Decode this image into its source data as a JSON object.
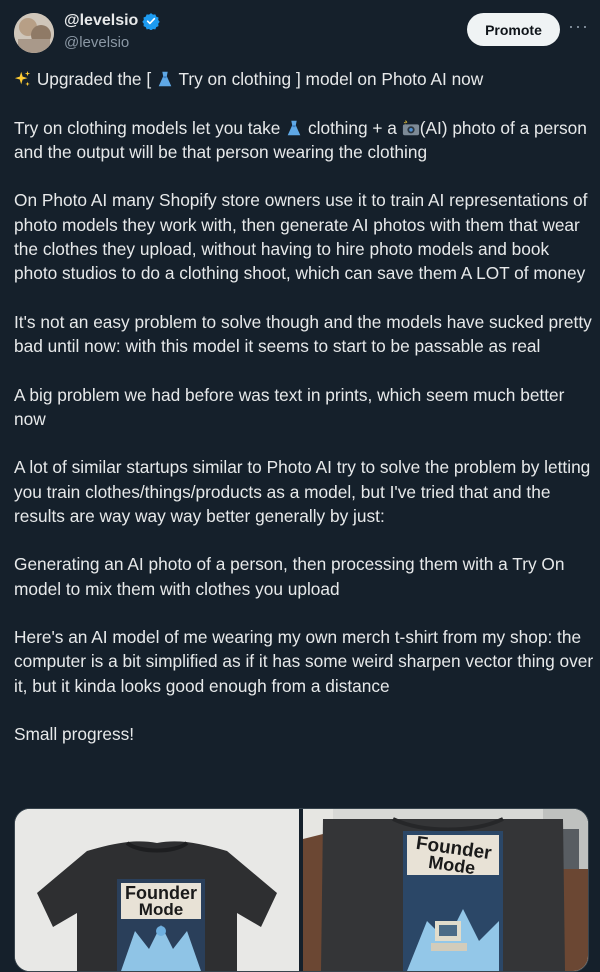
{
  "author": {
    "display_name": "@levelsio",
    "handle": "@levelsio",
    "verified": true
  },
  "actions": {
    "promote_label": "Promote",
    "more_label": "···"
  },
  "tweet": {
    "p1": {
      "pre": "Upgraded the [ ",
      "mid": " Try on clothing ] model on Photo AI now"
    },
    "p2": {
      "a": "Try on clothing models let you take ",
      "b": " clothing + a ",
      "c": "(AI) photo of a person and the output will be that person wearing the clothing"
    },
    "p3": "On Photo AI many Shopify store owners use it to train AI representations of photo models they work with, then generate AI photos with them that wear the clothes they upload, without having to hire photo models and book photo studios to do a clothing shoot, which can save them A LOT of money",
    "p4": "It's not an easy problem to solve though and the models have sucked pretty bad until now: with this model it seems to start to be passable as real",
    "p5": "A big problem we had before was text in prints, which seem much better now",
    "p6": "A lot of similar startups similar to Photo AI try to solve the problem by letting you train clothes/things/products as a model, but I've tried that and the results are way way way better generally by just:",
    "p7": "Generating an AI photo of a person, then processing them with a Try On model to mix them with clothes you upload",
    "p8": "Here's an AI model of me wearing my own merch t-shirt from my shop: the computer is a bit simplified as if it has some weird sharpen vector thing over it, but it kinda looks good enough from a distance",
    "p9": "Small progress!"
  },
  "media": {
    "left_shirt_text_1": "Founder",
    "left_shirt_text_2": "Mode",
    "right_shirt_text_1": "Founder",
    "right_shirt_text_2": "Mode"
  },
  "icons": {
    "verified": "verified-badge-icon",
    "sparkles": "sparkles-icon",
    "dress": "dress-icon",
    "camera_flash": "camera-flash-icon",
    "more": "more-dots-icon"
  },
  "colors": {
    "background": "#15202b",
    "text": "#e7e9ea",
    "muted": "#8b98a5",
    "verified": "#1d9bf0",
    "promote_bg": "#eff3f4"
  }
}
